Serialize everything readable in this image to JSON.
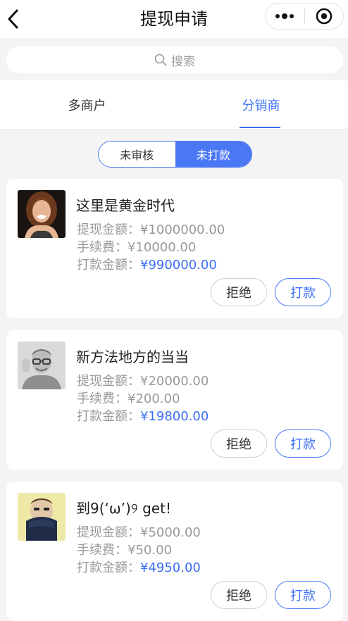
{
  "navbar": {
    "title": "提现申请",
    "back_icon": "chevron-left-icon",
    "menu_icon": "more-dots-icon",
    "close_icon": "target-circle-icon"
  },
  "search": {
    "placeholder": "搜索",
    "icon": "search-icon"
  },
  "tabs": [
    {
      "label": "多商户",
      "active": false
    },
    {
      "label": "分销商",
      "active": true
    }
  ],
  "filter": {
    "options": [
      {
        "label": "未审核",
        "active": false
      },
      {
        "label": "未打款",
        "active": true
      }
    ]
  },
  "colors": {
    "accent": "#3b6ff5",
    "muted": "#999999",
    "background": "#f4f4f4"
  },
  "labels": {
    "amount": "提现金额：",
    "fee": "手续费：",
    "pay_amount": "打款金额："
  },
  "records": [
    {
      "name": "这里是黄金时代",
      "amount": "¥1000000.00",
      "fee": "¥10000.00",
      "pay_amount": "¥990000.00",
      "reject_label": "拒绝",
      "pay_label": "打款"
    },
    {
      "name": "新方法地方的当当",
      "amount": "¥20000.00",
      "fee": "¥200.00",
      "pay_amount": "¥19800.00",
      "reject_label": "拒绝",
      "pay_label": "打款"
    },
    {
      "name": "到9(‘ω’)୨ get!",
      "amount": "¥5000.00",
      "fee": "¥50.00",
      "pay_amount": "¥4950.00",
      "reject_label": "拒绝",
      "pay_label": "打款"
    }
  ]
}
